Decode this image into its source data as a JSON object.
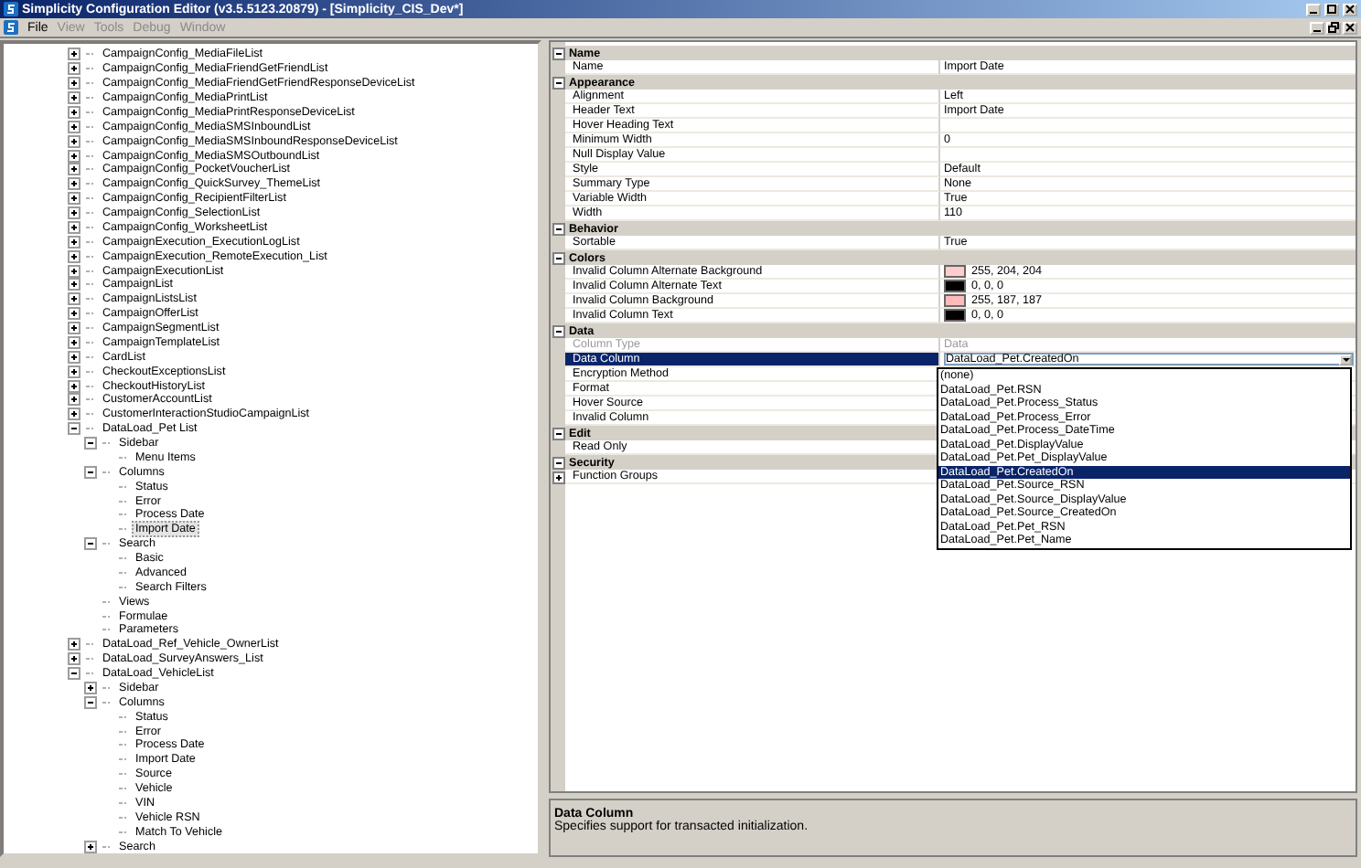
{
  "window": {
    "title": "Simplicity Configuration Editor (v3.5.5123.20879) - [Simplicity_CIS_Dev*]"
  },
  "menu": [
    {
      "label": "File",
      "disabled": false
    },
    {
      "label": "View",
      "disabled": true
    },
    {
      "label": "Tools",
      "disabled": true
    },
    {
      "label": "Debug",
      "disabled": true
    },
    {
      "label": "Window",
      "disabled": true
    }
  ],
  "tree": [
    {
      "label": "CampaignConfig_MediaFileList",
      "expanded": false,
      "selected": false
    },
    {
      "label": "CampaignConfig_MediaFriendGetFriendList",
      "expanded": false,
      "selected": false
    },
    {
      "label": "CampaignConfig_MediaFriendGetFriendResponseDeviceList",
      "expanded": false,
      "selected": false
    },
    {
      "label": "CampaignConfig_MediaPrintList",
      "expanded": false,
      "selected": false
    },
    {
      "label": "CampaignConfig_MediaPrintResponseDeviceList",
      "expanded": false,
      "selected": false
    },
    {
      "label": "CampaignConfig_MediaSMSInboundList",
      "expanded": false,
      "selected": false
    },
    {
      "label": "CampaignConfig_MediaSMSInboundResponseDeviceList",
      "expanded": false,
      "selected": false
    },
    {
      "label": "CampaignConfig_MediaSMSOutboundList",
      "expanded": false,
      "selected": false
    },
    {
      "label": "CampaignConfig_PocketVoucherList",
      "expanded": false,
      "selected": false
    },
    {
      "label": "CampaignConfig_QuickSurvey_ThemeList",
      "expanded": false,
      "selected": false
    },
    {
      "label": "CampaignConfig_RecipientFilterList",
      "expanded": false,
      "selected": false
    },
    {
      "label": "CampaignConfig_SelectionList",
      "expanded": false,
      "selected": false
    },
    {
      "label": "CampaignConfig_WorksheetList",
      "expanded": false,
      "selected": false
    },
    {
      "label": "CampaignExecution_ExecutionLogList",
      "expanded": false,
      "selected": false
    },
    {
      "label": "CampaignExecution_RemoteExecution_List",
      "expanded": false,
      "selected": false
    },
    {
      "label": "CampaignExecutionList",
      "expanded": false,
      "selected": false
    },
    {
      "label": "CampaignList",
      "expanded": false,
      "selected": false
    },
    {
      "label": "CampaignListsList",
      "expanded": false,
      "selected": false
    },
    {
      "label": "CampaignOfferList",
      "expanded": false,
      "selected": false
    },
    {
      "label": "CampaignSegmentList",
      "expanded": false,
      "selected": false
    },
    {
      "label": "CampaignTemplateList",
      "expanded": false,
      "selected": false
    },
    {
      "label": "CardList",
      "expanded": false,
      "selected": false
    },
    {
      "label": "CheckoutExceptionsList",
      "expanded": false,
      "selected": false
    },
    {
      "label": "CheckoutHistoryList",
      "expanded": false,
      "selected": false
    },
    {
      "label": "CustomerAccountList",
      "expanded": false,
      "selected": false
    },
    {
      "label": "CustomerInteractionStudioCampaignList",
      "expanded": false,
      "selected": false
    },
    {
      "label": "DataLoad_Pet List",
      "expanded": true,
      "selected": false,
      "children": [
        {
          "label": "Sidebar",
          "expanded": true,
          "selected": false,
          "children": [
            {
              "label": "Menu Items",
              "selected": false
            }
          ]
        },
        {
          "label": "Columns",
          "expanded": true,
          "selected": false,
          "children": [
            {
              "label": "Status",
              "selected": false
            },
            {
              "label": "Error",
              "selected": false
            },
            {
              "label": "Process Date",
              "selected": false
            },
            {
              "label": "Import Date",
              "selected": true
            }
          ]
        },
        {
          "label": "Search",
          "expanded": true,
          "selected": false,
          "children": [
            {
              "label": "Basic",
              "selected": false
            },
            {
              "label": "Advanced",
              "selected": false
            },
            {
              "label": "Search Filters",
              "selected": false
            }
          ]
        },
        {
          "label": "Views",
          "selected": false
        },
        {
          "label": "Formulae",
          "selected": false
        },
        {
          "label": "Parameters",
          "selected": false
        }
      ]
    },
    {
      "label": "DataLoad_Ref_Vehicle_OwnerList",
      "expanded": false,
      "selected": false
    },
    {
      "label": "DataLoad_SurveyAnswers_List",
      "expanded": false,
      "selected": false
    },
    {
      "label": "DataLoad_VehicleList",
      "expanded": true,
      "selected": false,
      "children": [
        {
          "label": "Sidebar",
          "expanded": false,
          "selected": false
        },
        {
          "label": "Columns",
          "expanded": true,
          "selected": false,
          "children": [
            {
              "label": "Status",
              "selected": false
            },
            {
              "label": "Error",
              "selected": false
            },
            {
              "label": "Process Date",
              "selected": false
            },
            {
              "label": "Import Date",
              "selected": false
            },
            {
              "label": "Source",
              "selected": false
            },
            {
              "label": "Vehicle",
              "selected": false
            },
            {
              "label": "VIN",
              "selected": false
            },
            {
              "label": "Vehicle RSN",
              "selected": false
            },
            {
              "label": "Match To Vehicle",
              "selected": false
            }
          ]
        },
        {
          "label": "Search",
          "expanded": false,
          "selected": false
        }
      ]
    }
  ],
  "properties": {
    "categories": [
      {
        "name": "Name",
        "expanded": true,
        "rows": [
          {
            "kind": "text",
            "name": "Name",
            "value": "Import Date",
            "selected": false,
            "disabled": false
          }
        ]
      },
      {
        "name": "Appearance",
        "expanded": true,
        "rows": [
          {
            "kind": "text",
            "name": "Alignment",
            "value": "Left",
            "selected": false,
            "disabled": false
          },
          {
            "kind": "text",
            "name": "Header Text",
            "value": "Import Date",
            "selected": false,
            "disabled": false
          },
          {
            "kind": "text",
            "name": "Hover Heading Text",
            "selected": false,
            "disabled": false
          },
          {
            "kind": "text",
            "name": "Minimum Width",
            "value": "0",
            "selected": false,
            "disabled": false
          },
          {
            "kind": "text",
            "name": "Null Display Value",
            "selected": false,
            "disabled": false
          },
          {
            "kind": "text",
            "name": "Style",
            "value": "Default",
            "selected": false,
            "disabled": false
          },
          {
            "kind": "text",
            "name": "Summary Type",
            "value": "None",
            "selected": false,
            "disabled": false
          },
          {
            "kind": "text",
            "name": "Variable Width",
            "value": "True",
            "selected": false,
            "disabled": false
          },
          {
            "kind": "text",
            "name": "Width",
            "value": "110",
            "selected": false,
            "disabled": false
          }
        ]
      },
      {
        "name": "Behavior",
        "expanded": true,
        "rows": [
          {
            "kind": "text",
            "name": "Sortable",
            "value": "True",
            "selected": false,
            "disabled": false
          }
        ]
      },
      {
        "name": "Colors",
        "expanded": true,
        "rows": [
          {
            "kind": "color",
            "name": "Invalid Column Alternate Background",
            "value": "255, 204, 204",
            "color": "#ffcccc",
            "selected": false,
            "disabled": false
          },
          {
            "kind": "color",
            "name": "Invalid Column Alternate Text",
            "value": "0, 0, 0",
            "color": "#000000",
            "selected": false,
            "disabled": false
          },
          {
            "kind": "color",
            "name": "Invalid Column Background",
            "value": "255, 187, 187",
            "color": "#ffbbbb",
            "selected": false,
            "disabled": false
          },
          {
            "kind": "color",
            "name": "Invalid Column Text",
            "value": "0, 0, 0",
            "color": "#000000",
            "selected": false,
            "disabled": false
          }
        ]
      },
      {
        "name": "Data",
        "expanded": true,
        "rows": [
          {
            "kind": "text",
            "name": "Column Type",
            "value": "Data",
            "selected": false,
            "disabled": true
          },
          {
            "kind": "dropdown",
            "name": "Data Column",
            "value": "DataLoad_Pet.CreatedOn",
            "selected": true,
            "disabled": false
          },
          {
            "kind": "text",
            "name": "Encryption Method",
            "selected": false,
            "disabled": false
          },
          {
            "kind": "text",
            "name": "Format",
            "selected": false,
            "disabled": false
          },
          {
            "kind": "text",
            "name": "Hover Source",
            "selected": false,
            "disabled": false
          },
          {
            "kind": "text",
            "name": "Invalid Column",
            "selected": false,
            "disabled": false
          }
        ]
      },
      {
        "name": "Edit",
        "expanded": true,
        "rows": [
          {
            "kind": "text",
            "name": "Read Only",
            "selected": false,
            "disabled": false
          }
        ]
      },
      {
        "name": "Security",
        "expanded": true,
        "rows": [
          {
            "kind": "group",
            "name": "Function Groups",
            "expanded": false,
            "selected": false,
            "disabled": false
          }
        ]
      }
    ],
    "dropdown_options": [
      {
        "label": "(none)",
        "selected": false
      },
      {
        "label": "DataLoad_Pet.RSN",
        "selected": false
      },
      {
        "label": "DataLoad_Pet.Process_Status",
        "selected": false
      },
      {
        "label": "DataLoad_Pet.Process_Error",
        "selected": false
      },
      {
        "label": "DataLoad_Pet.Process_DateTime",
        "selected": false
      },
      {
        "label": "DataLoad_Pet.DisplayValue",
        "selected": false
      },
      {
        "label": "DataLoad_Pet.Pet_DisplayValue",
        "selected": false
      },
      {
        "label": "DataLoad_Pet.CreatedOn",
        "selected": true
      },
      {
        "label": "DataLoad_Pet.Source_RSN",
        "selected": false
      },
      {
        "label": "DataLoad_Pet.Source_DisplayValue",
        "selected": false
      },
      {
        "label": "DataLoad_Pet.Source_CreatedOn",
        "selected": false
      },
      {
        "label": "DataLoad_Pet.Pet_RSN",
        "selected": false
      },
      {
        "label": "DataLoad_Pet.Pet_Name",
        "selected": false
      }
    ]
  },
  "description": {
    "title": "Data Column",
    "text": "Specifies support for transacted initialization."
  }
}
